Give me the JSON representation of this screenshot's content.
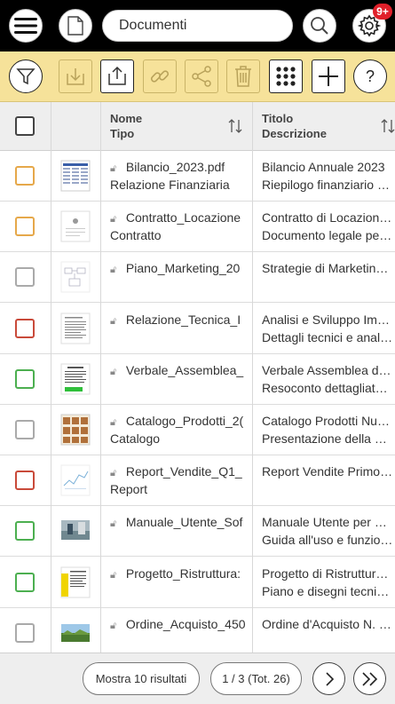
{
  "header": {
    "search_value": "Documenti",
    "notification_badge": "9+"
  },
  "toolbar": {
    "icons": [
      "filter-icon",
      "download-icon",
      "upload-icon",
      "link-icon",
      "share-icon",
      "trash-icon",
      "grid-icon",
      "plus-icon",
      "help-icon"
    ]
  },
  "table": {
    "col_name_line1": "Nome",
    "col_name_line2": "Tipo",
    "col_title_line1": "Titolo",
    "col_title_line2": "Descrizione",
    "rows": [
      {
        "checkbox_color": "#e6a84a",
        "name": "Bilancio_2023.pdf",
        "type": "Relazione Finanziaria",
        "title": "Bilancio Annuale 2023",
        "description": "Riepilogo finanziario …",
        "thumb": "table"
      },
      {
        "checkbox_color": "#e6a84a",
        "name": "Contratto_Locazione",
        "type": "Contratto",
        "title": "Contratto di Locazion…",
        "description": "Documento legale pe…",
        "thumb": "doc"
      },
      {
        "checkbox_color": "#aaaaaa",
        "name": "Piano_Marketing_20",
        "type": "",
        "title": "Strategie di Marketin…",
        "description": "",
        "thumb": "sketch"
      },
      {
        "checkbox_color": "#c94a3a",
        "name": "Relazione_Tecnica_I",
        "type": "",
        "title": "Analisi e Sviluppo Im…",
        "description": "Dettagli tecnici e anal…",
        "thumb": "text"
      },
      {
        "checkbox_color": "#4caf50",
        "name": "Verbale_Assemblea_",
        "type": "",
        "title": "Verbale Assemblea d…",
        "description": "Resoconto dettagliat…",
        "thumb": "greentext"
      },
      {
        "checkbox_color": "#aaaaaa",
        "name": "Catalogo_Prodotti_2(",
        "type": "Catalogo",
        "title": "Catalogo Prodotti Nu…",
        "description": "Presentazione della …",
        "thumb": "catalog"
      },
      {
        "checkbox_color": "#c94a3a",
        "name": "Report_Vendite_Q1_",
        "type": "Report",
        "title": "Report Vendite Primo…",
        "description": "",
        "thumb": "chart"
      },
      {
        "checkbox_color": "#4caf50",
        "name": "Manuale_Utente_Sof",
        "type": "",
        "title": "Manuale Utente per …",
        "description": "Guida all'uso e funzio…",
        "thumb": "photo"
      },
      {
        "checkbox_color": "#4caf50",
        "name": "Progetto_Ristruttura:",
        "type": "",
        "title": "Progetto di Ristruttur…",
        "description": "Piano e disegni tecni…",
        "thumb": "yellowdoc"
      },
      {
        "checkbox_color": "#aaaaaa",
        "name": "Ordine_Acquisto_450",
        "type": "",
        "title": "Ordine d'Acquisto N. …",
        "description": "",
        "thumb": "landscape"
      }
    ]
  },
  "footer": {
    "show_results": "Mostra 10 risultati",
    "pagination": "1 / 3 (Tot. 26)"
  }
}
